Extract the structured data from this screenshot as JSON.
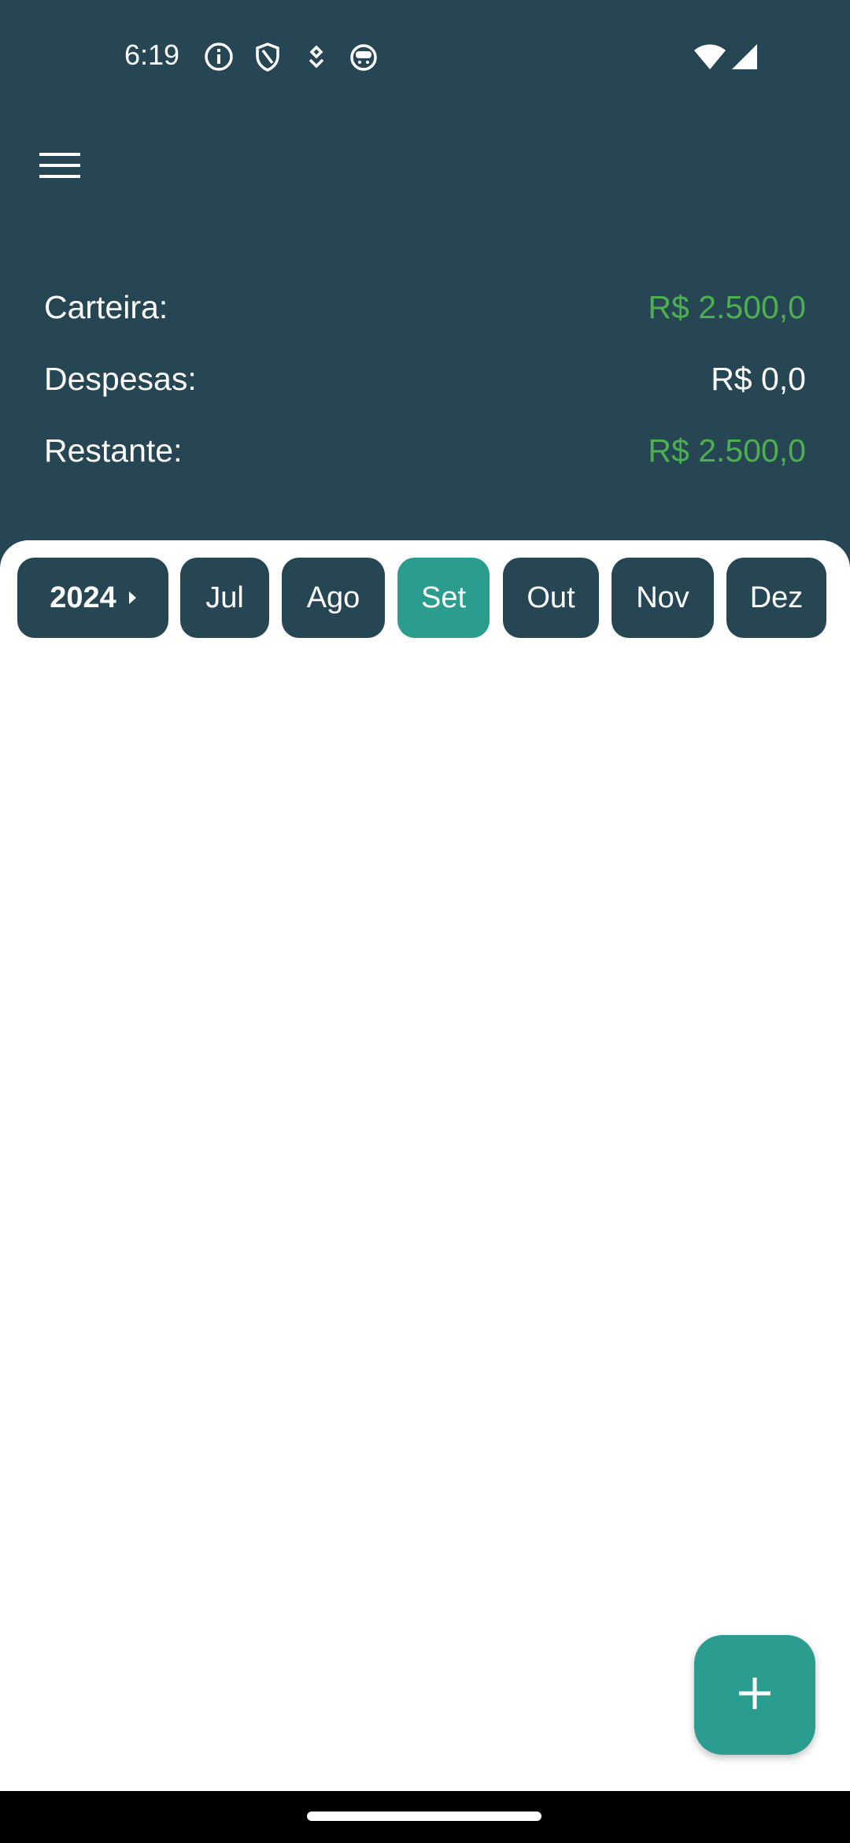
{
  "status_bar": {
    "time": "6:19",
    "icons": [
      "info-icon",
      "shield-icon",
      "location-icon",
      "robot-icon",
      "wifi-icon",
      "signal-icon"
    ]
  },
  "header": {
    "menu_icon": "hamburger-menu-icon"
  },
  "summary": {
    "wallet_label": "Carteira:",
    "wallet_value": "R$ 2.500,0",
    "expenses_label": "Despesas:",
    "expenses_value": "R$ 0,0",
    "remaining_label": "Restante:",
    "remaining_value": "R$ 2.500,0"
  },
  "month_selector": {
    "year": "2024",
    "months": [
      "Jul",
      "Ago",
      "Set",
      "Out",
      "Nov",
      "Dez"
    ],
    "selected": "Set"
  },
  "fab": {
    "icon": "plus-icon"
  },
  "colors": {
    "header_bg": "#264653",
    "chip_bg": "#264653",
    "accent": "#2a9d8f",
    "positive": "#4caf50",
    "text_on_dark": "#ffffff"
  }
}
